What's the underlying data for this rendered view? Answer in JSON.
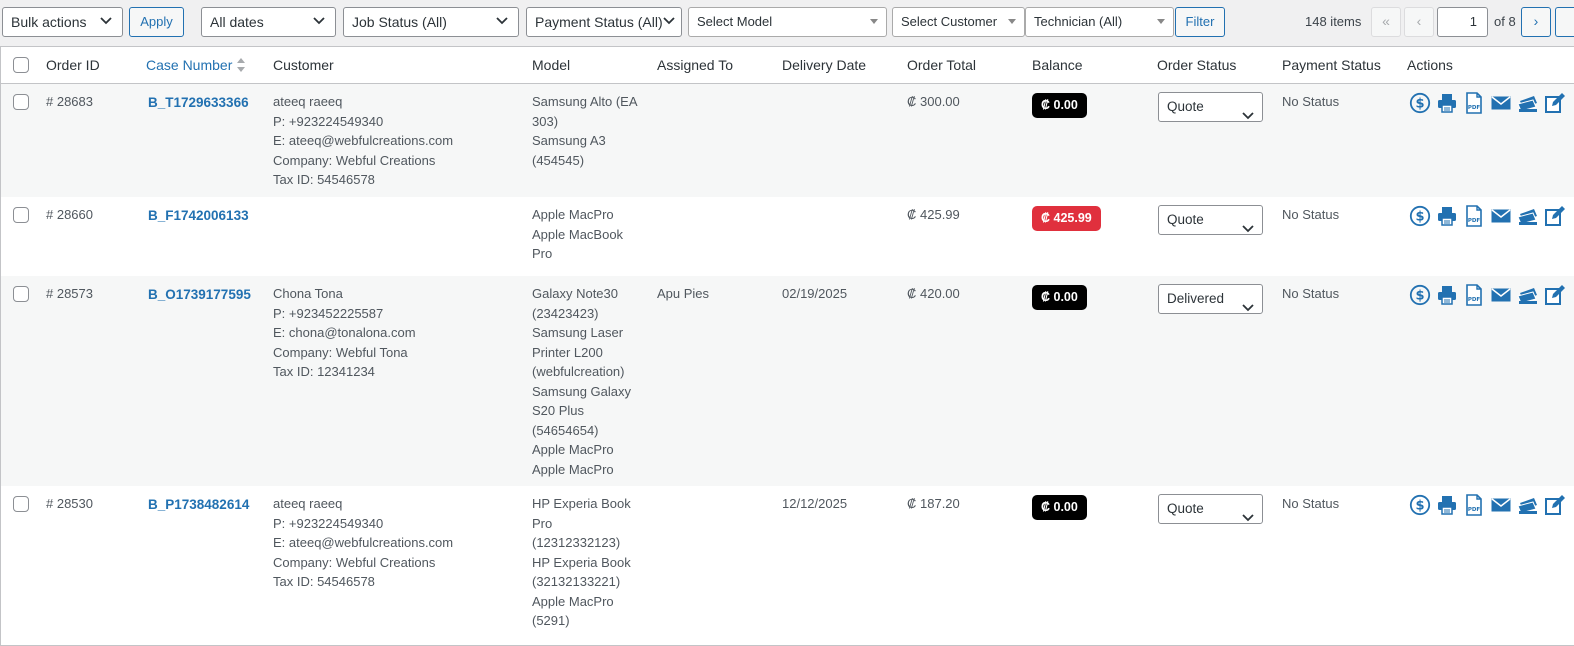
{
  "toolbar": {
    "bulk_actions": "Bulk actions",
    "apply_label": "Apply",
    "dates": "All dates",
    "job_status": "Job Status (All)",
    "payment_status": "Payment Status (All)",
    "model": "Select Model",
    "customer": "Select Customer",
    "technician": "Technician (All)",
    "filter_label": "Filter"
  },
  "pagination": {
    "items_count": "148 items",
    "first": "«",
    "prev": "‹",
    "current_page": "1",
    "of_pages": "of 8",
    "next": "›"
  },
  "columns": {
    "order_id": "Order ID",
    "case_number": "Case Number",
    "customer": "Customer",
    "model": "Model",
    "assigned_to": "Assigned To",
    "delivery_date": "Delivery Date",
    "order_total": "Order Total",
    "balance": "Balance",
    "order_status": "Order Status",
    "payment_status": "Payment Status",
    "actions": "Actions"
  },
  "rows": [
    {
      "order_id": "# 28683",
      "case_number": "B_T1729633366",
      "customer": [
        "ateeq raeeq",
        "P: +923224549340",
        "E: ateeq@webfulcreations.com",
        "Company: Webful Creations",
        "Tax ID: 54546578"
      ],
      "model": [
        "Samsung Alto (EA",
        "303)",
        "Samsung A3",
        "(454545)"
      ],
      "assigned_to": "",
      "delivery_date": "",
      "order_total": "₡ 300.00",
      "balance": "₡ 0.00",
      "balance_state": "paid",
      "order_status": "Quote",
      "payment_status": "No Status"
    },
    {
      "order_id": "# 28660",
      "case_number": "B_F1742006133",
      "customer": [],
      "model": [
        "Apple MacPro",
        "Apple MacBook",
        "Pro"
      ],
      "assigned_to": "",
      "delivery_date": "",
      "order_total": "₡ 425.99",
      "balance": "₡ 425.99",
      "balance_state": "due",
      "order_status": "Quote",
      "payment_status": "No Status"
    },
    {
      "order_id": "# 28573",
      "case_number": "B_O1739177595",
      "customer": [
        "Chona Tona",
        "P: +923452225587",
        "E: chona@tonalona.com",
        "Company: Webful Tona",
        "Tax ID: 12341234"
      ],
      "model": [
        "Galaxy Note30",
        "(23423423)",
        "Samsung Laser",
        "Printer L200",
        "(webfulcreation)",
        "Samsung Galaxy",
        "S20 Plus",
        "(54654654)",
        "Apple MacPro",
        "Apple MacPro"
      ],
      "assigned_to": "Apu Pies",
      "delivery_date": "02/19/2025",
      "order_total": "₡ 420.00",
      "balance": "₡ 0.00",
      "balance_state": "paid",
      "order_status": "Delivered",
      "payment_status": "No Status"
    },
    {
      "order_id": "# 28530",
      "case_number": "B_P1738482614",
      "customer": [
        "ateeq raeeq",
        "P: +923224549340",
        "E: ateeq@webfulcreations.com",
        "Company: Webful Creations",
        "Tax ID: 54546578"
      ],
      "model": [
        "HP Experia Book",
        "Pro",
        "(12312332123)",
        "HP Experia Book",
        "(32132133221)",
        "Apple MacPro",
        "(5291)"
      ],
      "assigned_to": "",
      "delivery_date": "12/12/2025",
      "order_total": "₡ 187.20",
      "balance": "₡ 0.00",
      "balance_state": "paid",
      "order_status": "Quote",
      "payment_status": "No Status"
    }
  ],
  "action_icons": [
    "dollar-icon",
    "print-icon",
    "pdf-icon",
    "email-icon",
    "payments-icon",
    "edit-icon"
  ],
  "colors": {
    "link": "#2271b1",
    "balance_paid": "#000000",
    "balance_due": "#e0303d",
    "row_alt": "#f6f7f7"
  }
}
